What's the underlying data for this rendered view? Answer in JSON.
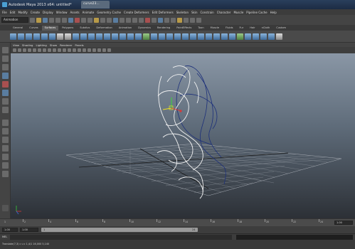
{
  "window": {
    "title": "Autodesk Maya 2013 x64: untitled*",
    "second_tab": "curve23..."
  },
  "menus": [
    "File",
    "Edit",
    "Modify",
    "Create",
    "Display",
    "Window",
    "Assets",
    "Animate",
    "Geometry Cache",
    "Create Deformers",
    "Edit Deformers",
    "Skeleton",
    "Skin",
    "Constrain",
    "Character",
    "Muscle",
    "Pipeline Cache",
    "Help"
  ],
  "status": {
    "mode": "Animation"
  },
  "shelf_tabs": [
    "General",
    "Curves",
    "Surfaces",
    "Polygons",
    "Subdivs",
    "Deformation",
    "Animation",
    "Dynamics",
    "Rendering",
    "PaintEffects",
    "Toon",
    "Muscle",
    "Fluids",
    "Fur",
    "Hair",
    "nCloth",
    "Custom"
  ],
  "shelf_active": "Surfaces",
  "panel_menus": [
    "View",
    "Shading",
    "Lighting",
    "Show",
    "Renderer",
    "Panels"
  ],
  "timeline": {
    "ticks": [
      "1",
      "2",
      "4",
      "6",
      "8",
      "10",
      "12",
      "14",
      "16",
      "18",
      "20",
      "22",
      "24"
    ],
    "current": "1.00"
  },
  "range": {
    "start": "1.00",
    "inner_start": "1.00",
    "slider_start": "1",
    "slider_end": "24"
  },
  "command": {
    "label": "MEL"
  },
  "help": {
    "text": "Translate(7,3) c u c   1,4/1   16,000   5,140"
  },
  "colors": {
    "accent": "#4a9fd4",
    "curve_white": "#f4f4f4",
    "curve_blue": "#1c2f7a"
  }
}
